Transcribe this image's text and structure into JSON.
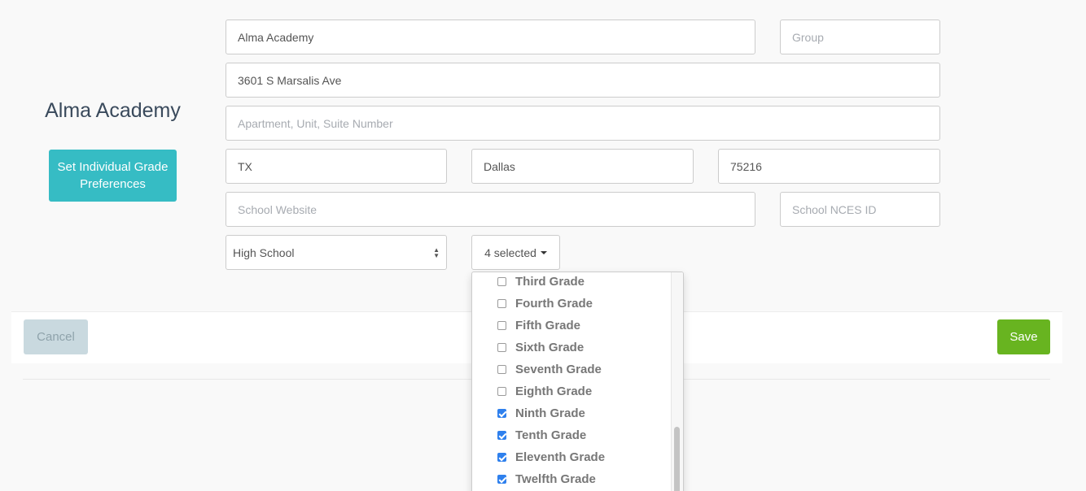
{
  "school": {
    "title": "Alma Academy",
    "grade_pref_button": "Set Individual Grade Preferences"
  },
  "form": {
    "name": {
      "value": "Alma Academy",
      "placeholder": ""
    },
    "group": {
      "value": "",
      "placeholder": "Group"
    },
    "address": {
      "value": "3601 S Marsalis Ave",
      "placeholder": ""
    },
    "address2": {
      "value": "",
      "placeholder": "Apartment, Unit, Suite Number"
    },
    "state": {
      "value": "TX",
      "placeholder": ""
    },
    "city": {
      "value": "Dallas",
      "placeholder": ""
    },
    "zip": {
      "value": "75216",
      "placeholder": ""
    },
    "website": {
      "value": "",
      "placeholder": "School Website"
    },
    "nces_id": {
      "value": "",
      "placeholder": "School NCES ID"
    },
    "school_type": {
      "selected": "High School"
    },
    "grades": {
      "toggle_label": "4 selected",
      "options": [
        {
          "label": "Third Grade",
          "checked": false
        },
        {
          "label": "Fourth Grade",
          "checked": false
        },
        {
          "label": "Fifth Grade",
          "checked": false
        },
        {
          "label": "Sixth Grade",
          "checked": false
        },
        {
          "label": "Seventh Grade",
          "checked": false
        },
        {
          "label": "Eighth Grade",
          "checked": false
        },
        {
          "label": "Ninth Grade",
          "checked": true
        },
        {
          "label": "Tenth Grade",
          "checked": true
        },
        {
          "label": "Eleventh Grade",
          "checked": true
        },
        {
          "label": "Twelfth Grade",
          "checked": true
        }
      ]
    }
  },
  "footer": {
    "cancel_label": "Cancel",
    "save_label": "Save"
  },
  "colors": {
    "accent_teal": "#36bcc4",
    "save_green": "#68b420",
    "cancel_gray": "#c9d9df",
    "checkbox_blue": "#2f80ed"
  }
}
